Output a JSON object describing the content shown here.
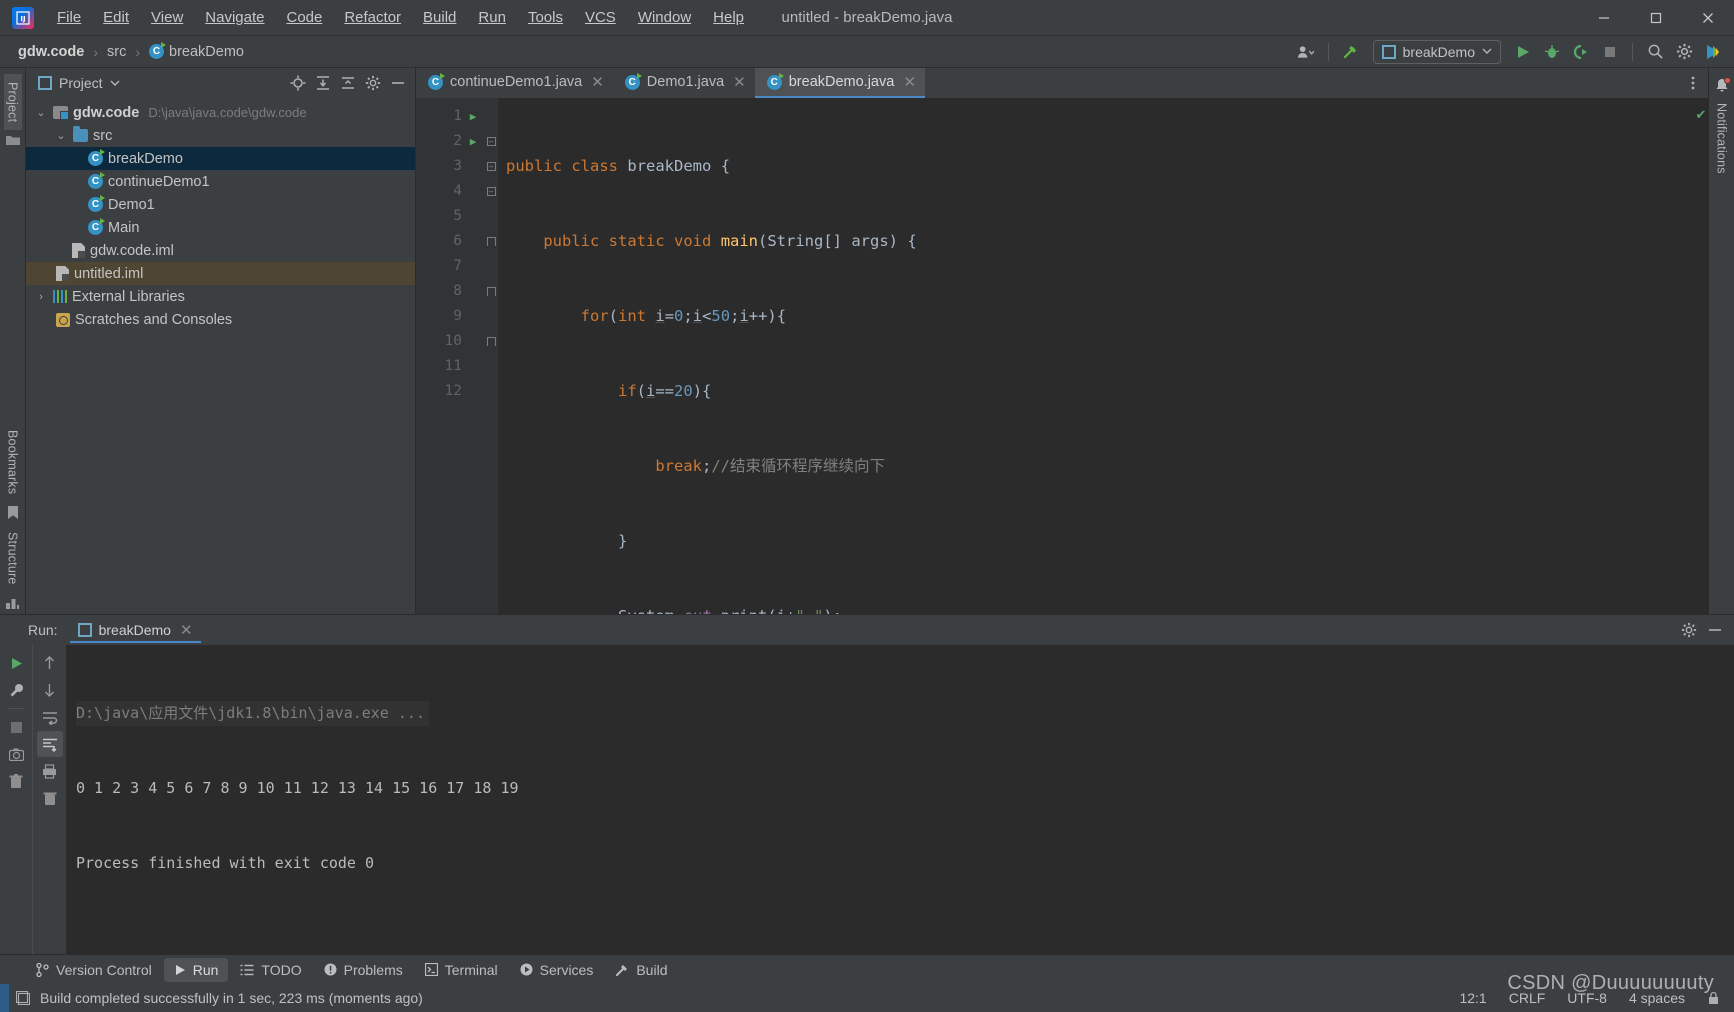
{
  "window": {
    "title": "untitled - breakDemo.java",
    "minimize_label": "—",
    "maximize_label": "☐",
    "close_label": "✕"
  },
  "menubar": {
    "items": [
      {
        "label": "File"
      },
      {
        "label": "Edit"
      },
      {
        "label": "View"
      },
      {
        "label": "Navigate"
      },
      {
        "label": "Code"
      },
      {
        "label": "Refactor"
      },
      {
        "label": "Build"
      },
      {
        "label": "Run"
      },
      {
        "label": "Tools"
      },
      {
        "label": "VCS"
      },
      {
        "label": "Window"
      },
      {
        "label": "Help"
      }
    ]
  },
  "navbar": {
    "breadcrumbs": [
      {
        "label": "gdw.code",
        "icon": "none"
      },
      {
        "label": "src",
        "icon": "none"
      },
      {
        "label": "breakDemo",
        "icon": "class-icon"
      }
    ],
    "separator": "›",
    "run_config": "breakDemo",
    "icons": {
      "user": "user-icon",
      "hammer": "build-hammer-icon",
      "dropdown": "chevron-down-icon",
      "run": "run-icon",
      "debug": "debug-icon",
      "run_coverage": "run-with-coverage-icon",
      "stop": "stop-icon",
      "search": "search-icon",
      "settings": "gear-icon",
      "updates": "ide-updates-icon"
    }
  },
  "left_rail": {
    "project_label": "Project",
    "bookmarks_label": "Bookmarks",
    "structure_label": "Structure"
  },
  "right_rail": {
    "notifications_label": "Notifications"
  },
  "project_panel": {
    "title": "Project",
    "toolbar_icons": [
      "locate-icon",
      "expand-all-icon",
      "collapse-all-icon",
      "gear-icon",
      "hide-icon"
    ],
    "tree": [
      {
        "label": "gdw.code",
        "path": "D:\\java\\java.code\\gdw.code",
        "arrow": "⌄",
        "icon": "module-icon",
        "indent": 0,
        "state": "normal",
        "bold": true
      },
      {
        "label": "src",
        "path": "",
        "arrow": "⌄",
        "icon": "folder-icon",
        "indent": 1,
        "state": "normal",
        "bold": false
      },
      {
        "label": "breakDemo",
        "path": "",
        "arrow": "",
        "icon": "class-icon",
        "indent": 2,
        "state": "selected",
        "bold": false
      },
      {
        "label": "continueDemo1",
        "path": "",
        "arrow": "",
        "icon": "class-icon",
        "indent": 2,
        "state": "normal",
        "bold": false
      },
      {
        "label": "Demo1",
        "path": "",
        "arrow": "",
        "icon": "class-icon",
        "indent": 2,
        "state": "normal",
        "bold": false
      },
      {
        "label": "Main",
        "path": "",
        "arrow": "",
        "icon": "class-icon",
        "indent": 2,
        "state": "normal",
        "bold": false
      },
      {
        "label": "gdw.code.iml",
        "path": "",
        "arrow": "",
        "icon": "iml-icon",
        "indent": 1,
        "state": "normal",
        "bold": false
      },
      {
        "label": "untitled.iml",
        "path": "",
        "arrow": "",
        "icon": "iml-icon",
        "indent": 0,
        "state": "highlight",
        "bold": false
      },
      {
        "label": "External Libraries",
        "path": "",
        "arrow": "›",
        "icon": "library-icon",
        "indent": 0,
        "state": "normal",
        "bold": false
      },
      {
        "label": "Scratches and Consoles",
        "path": "",
        "arrow": "",
        "icon": "scratch-icon",
        "indent": 0,
        "state": "normal",
        "bold": false
      }
    ]
  },
  "editor": {
    "tabs": [
      {
        "label": "continueDemo1.java",
        "active": false,
        "close": "✕"
      },
      {
        "label": "Demo1.java",
        "active": false,
        "close": "✕"
      },
      {
        "label": "breakDemo.java",
        "active": true,
        "close": "✕"
      }
    ],
    "more_icon": "more-vertical-icon",
    "inspection_status": "✔",
    "line_numbers": [
      "1",
      "2",
      "3",
      "4",
      "5",
      "6",
      "7",
      "8",
      "9",
      "10",
      "11",
      "12"
    ],
    "gutter_run_rows": [
      1,
      2
    ],
    "code_lines": [
      "public class breakDemo {",
      "    public static void main(String[] args) {",
      "        for(int i=0;i<50;i++){",
      "            if(i==20){",
      "                break;//结束循环程序继续向下",
      "            }",
      "            System.out.print(i+\" \");",
      "        }",
      "",
      "    }",
      "}",
      ""
    ],
    "caret_line": 12
  },
  "run_panel": {
    "label": "Run:",
    "tab_label": "breakDemo",
    "tab_close": "✕",
    "toolbar_icons": [
      "rerun-icon",
      "wrench-icon",
      "stop-icon",
      "camera-icon",
      "trash-icon"
    ],
    "toolbar2_icons": [
      "up-arrow-icon",
      "down-arrow-icon",
      "soft-wrap-icon",
      "scroll-to-end-icon",
      "print-icon",
      "clear-all-icon"
    ],
    "settings_icon": "gear-icon",
    "hide_icon": "minimize-icon",
    "console": [
      {
        "text": "D:\\java\\应用文件\\jdk1.8\\bin\\java.exe ...",
        "style": "cmd"
      },
      {
        "text": "0 1 2 3 4 5 6 7 8 9 10 11 12 13 14 15 16 17 18 19",
        "style": "out"
      },
      {
        "text": "Process finished with exit code 0",
        "style": "out"
      }
    ]
  },
  "toolwindow_bar": {
    "items": [
      {
        "label": "Version Control",
        "icon": "branch-icon",
        "active": false
      },
      {
        "label": "Run",
        "icon": "run-icon",
        "active": true
      },
      {
        "label": "TODO",
        "icon": "todo-icon",
        "active": false
      },
      {
        "label": "Problems",
        "icon": "problems-icon",
        "active": false
      },
      {
        "label": "Terminal",
        "icon": "terminal-icon",
        "active": false
      },
      {
        "label": "Services",
        "icon": "services-icon",
        "active": false
      },
      {
        "label": "Build",
        "icon": "build-hammer-icon",
        "active": false
      }
    ]
  },
  "statusbar": {
    "message": "Build completed successfully in 1 sec, 223 ms (moments ago)",
    "message_icon": "event-log-icon",
    "position": "12:1",
    "line_separator": "CRLF",
    "encoding": "UTF-8",
    "indent": "4 spaces",
    "lock_icon": "lock-icon",
    "watermark": "CSDN @Duuuuuuuuty"
  },
  "colors": {
    "accent_blue": "#4a88c7",
    "selection_blue": "#0d293e",
    "highlight_tan": "#4e4632",
    "green_run": "#59a869",
    "keyword_orange": "#cc7832",
    "number_blue": "#6897bb",
    "string_green": "#6a8759",
    "comment_gray": "#808080",
    "field_purple": "#9876aa",
    "editor_bg": "#2b2b2b",
    "panel_bg": "#3c3f41"
  }
}
